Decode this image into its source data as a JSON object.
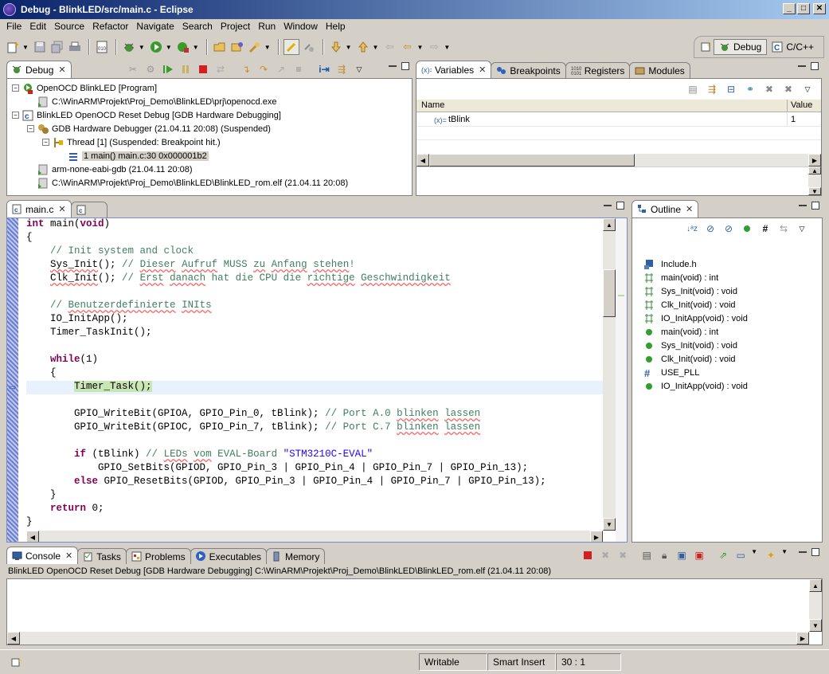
{
  "window": {
    "title": "Debug - BlinkLED/src/main.c - Eclipse",
    "controls": {
      "minimize": "_",
      "maximize": "□",
      "close": "✕"
    }
  },
  "menu": [
    "File",
    "Edit",
    "Source",
    "Refactor",
    "Navigate",
    "Search",
    "Project",
    "Run",
    "Window",
    "Help"
  ],
  "perspectives": [
    {
      "label": "Debug",
      "active": true
    },
    {
      "label": "C/C++",
      "active": false
    }
  ],
  "debug_view": {
    "tab_label": "Debug",
    "tree": [
      {
        "label": "OpenOCD BlinkLED [Program]",
        "indent": 0,
        "expander": "−",
        "icon": "program-launch-icon"
      },
      {
        "label": "C:\\WinARM\\Projekt\\Proj_Demo\\BlinkLED\\prj\\openocd.exe",
        "indent": 1,
        "expander": "",
        "icon": "process-icon"
      },
      {
        "label": "BlinkLED OpenOCD Reset Debug [GDB Hardware Debugging]",
        "indent": 0,
        "expander": "−",
        "icon": "c-launch-icon"
      },
      {
        "label": "GDB Hardware Debugger (21.04.11 20:08) (Suspended)",
        "indent": 1,
        "expander": "−",
        "icon": "debugger-icon"
      },
      {
        "label": "Thread [1] (Suspended: Breakpoint hit.)",
        "indent": 2,
        "expander": "−",
        "icon": "thread-icon"
      },
      {
        "label": "1 main() main.c:30 0x000001b2",
        "indent": 3,
        "expander": "",
        "icon": "stack-frame-icon",
        "selected": true
      },
      {
        "label": "arm-none-eabi-gdb (21.04.11 20:08)",
        "indent": 1,
        "expander": "",
        "icon": "process-icon"
      },
      {
        "label": "C:\\WinARM\\Projekt\\Proj_Demo\\BlinkLED\\BlinkLED_rom.elf (21.04.11 20:08)",
        "indent": 1,
        "expander": "",
        "icon": "process-icon"
      }
    ]
  },
  "variables_view": {
    "tabs": [
      "Variables",
      "Breakpoints",
      "Registers",
      "Modules"
    ],
    "columns": [
      "Name",
      "Value"
    ],
    "rows": [
      {
        "name": "tBlink",
        "value": "1"
      }
    ]
  },
  "editor": {
    "tabs": [
      "main.c",
      ""
    ],
    "current_line": 30
  },
  "outline": {
    "tab_label": "Outline",
    "items": [
      {
        "label": "Include.h",
        "kind": "include-icon"
      },
      {
        "label": "main(void) : int",
        "kind": "function-prototype-icon"
      },
      {
        "label": "Sys_Init(void) : void",
        "kind": "function-prototype-icon"
      },
      {
        "label": "Clk_Init(void) : void",
        "kind": "function-prototype-icon"
      },
      {
        "label": "IO_InitApp(void) : void",
        "kind": "function-prototype-icon"
      },
      {
        "label": "main(void) : int",
        "kind": "function-icon"
      },
      {
        "label": "Sys_Init(void) : void",
        "kind": "function-icon"
      },
      {
        "label": "Clk_Init(void) : void",
        "kind": "function-icon"
      },
      {
        "label": "USE_PLL",
        "kind": "macro-icon"
      },
      {
        "label": "IO_InitApp(void) : void",
        "kind": "function-icon"
      }
    ]
  },
  "console": {
    "tabs": [
      "Console",
      "Tasks",
      "Problems",
      "Executables",
      "Memory"
    ],
    "header": "BlinkLED OpenOCD Reset Debug [GDB Hardware Debugging] C:\\WinARM\\Projekt\\Proj_Demo\\BlinkLED\\BlinkLED_rom.elf (21.04.11 20:08)"
  },
  "statusbar": {
    "mode": "Writable",
    "insert": "Smart Insert",
    "position": "30 : 1"
  }
}
